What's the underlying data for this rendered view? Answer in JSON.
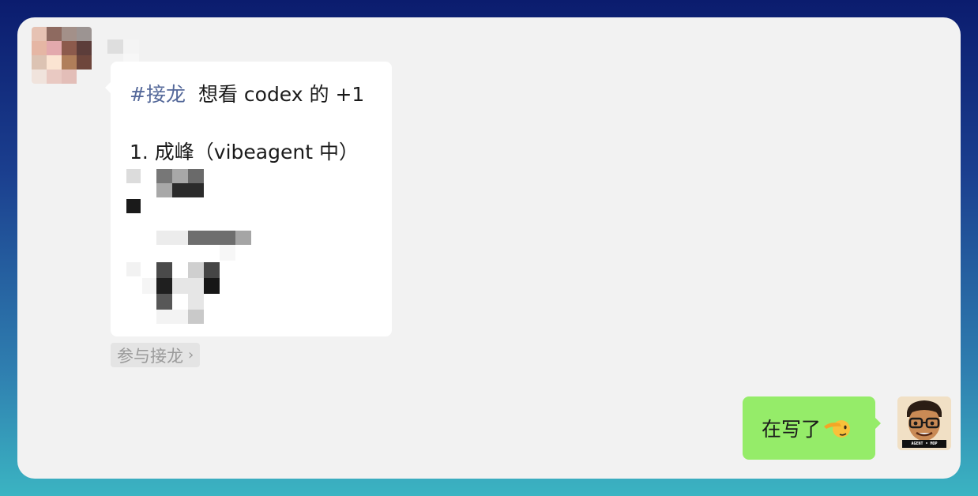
{
  "chat": {
    "incoming": {
      "hashtag": "#接龙",
      "title": "想看 codex 的 +1",
      "entry": "1. 成峰（vibeagent 中）"
    },
    "join_button": {
      "label": "参与接龙",
      "chevron": "›"
    },
    "outgoing": {
      "text": "在写了",
      "emoji": "saluting-face-icon"
    },
    "right_avatar": {
      "badge": "AGENT • MOP"
    }
  },
  "colors": {
    "window_bg": "#f2f2f2",
    "incoming_bubble": "#ffffff",
    "outgoing_bubble": "#95ec69",
    "hashtag": "#55699a",
    "join_button_bg": "#e4e4e4",
    "join_button_text": "#9a9a9a"
  }
}
